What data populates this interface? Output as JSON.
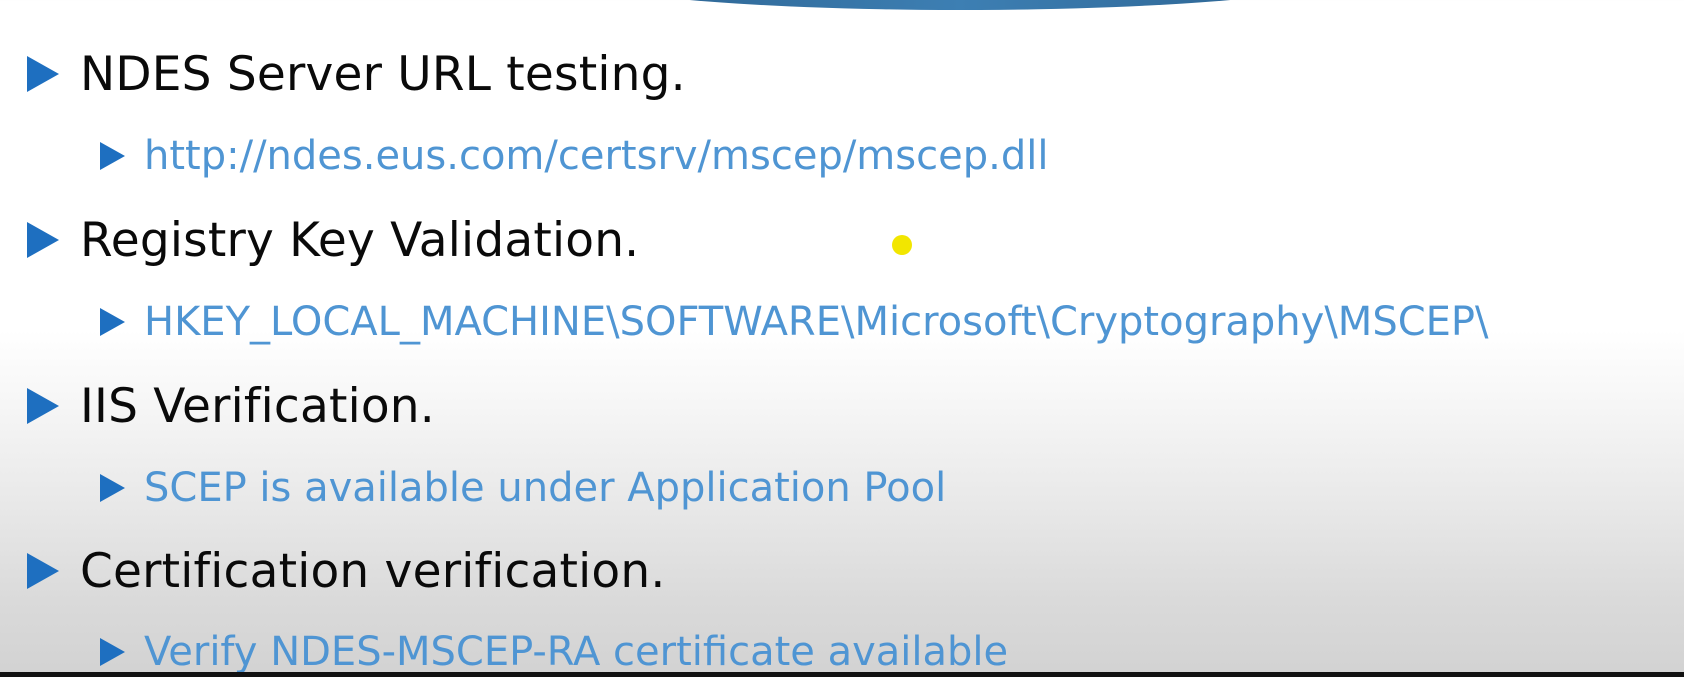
{
  "slide": {
    "items": [
      {
        "text": "NDES Server URL testing.",
        "sub": "http://ndes.eus.com/certsrv/mscep/mscep.dll"
      },
      {
        "text": "Registry Key Validation.",
        "sub": "HKEY_LOCAL_MACHINE\\SOFTWARE\\Microsoft\\Cryptography\\MSCEP\\"
      },
      {
        "text": "IIS Verification.",
        "sub": "SCEP is available under Application Pool"
      },
      {
        "text": "Certification verification.",
        "sub": "Verify NDES-MSCEP-RA certificate available"
      }
    ]
  },
  "colors": {
    "bullet": "#1e6fc0",
    "heading_text": "#0a0a0a",
    "sub_text": "#4f95d3",
    "pointer": "#f2e600",
    "accent_arc": "#2a5f8c"
  },
  "icons": {
    "bullet": "triangle-right-icon",
    "pointer": "laser-pointer-dot"
  }
}
